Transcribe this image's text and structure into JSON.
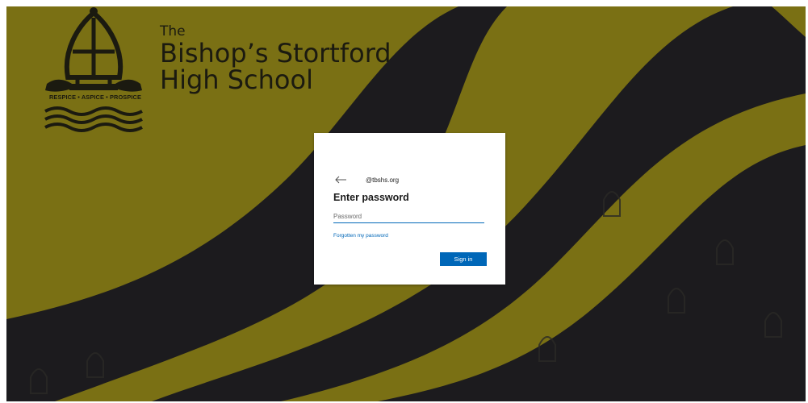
{
  "colors": {
    "olive": "#7a7014",
    "dark": "#1c1b1e",
    "accent": "#0067b8",
    "card": "#ffffff"
  },
  "branding": {
    "school_the": "The",
    "school_line1": "Bishop’s Stortford",
    "school_line2": "High School",
    "motto": "RESPICE • ASPICE • PROSPICE",
    "logo_icon": "mitre-crest-icon"
  },
  "signin": {
    "back_icon": "back-arrow-icon",
    "identity": "@tbshs.org",
    "title": "Enter password",
    "password_placeholder": "Password",
    "password_value": "",
    "forgot_label": "Forgotten my password",
    "submit_label": "Sign in"
  }
}
